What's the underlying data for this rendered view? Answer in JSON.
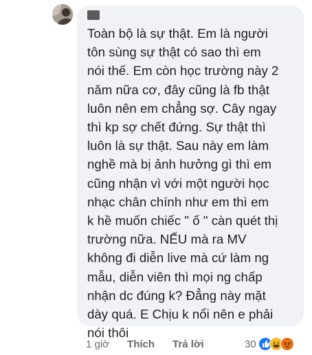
{
  "comment": {
    "author": "",
    "text": "Toàn bộ là sự thật. Em là người\ntôn sùng sự thật có sao thì em\nnói thế. Em còn học trường này 2\nnăm nữa cơ, đây cũng là fb thật\nluôn nên em chẳng sợ. Cây ngay\nthì kp sợ chết đứng. Sự thật thì\nluôn là sự thật. Sau này em làm\nnghề mà bị ảnh hưởng gì thì em\ncũng nhận vì với một người học\nnhạc chân chính như em thì em\nk hề muốn chiếc \" ố \" càn quét thị\ntrường nữa. NẾU mà ra MV\nkhông đi diễn live mà cứ làm ng\nmẫu, diễn viên thì mọi ng chấp\nnhận dc đúng k? Đẳng này mặt\ndày quá. E Chịu k nổi nên e phải\nnói thôi"
  },
  "actions": {
    "timestamp": "1 giờ",
    "like_label": "Thích",
    "reply_label": "Trả lời"
  },
  "reactions": {
    "count": "30",
    "icons": [
      "like-icon",
      "haha-icon",
      "angry-icon"
    ],
    "colors": {
      "like": "#1877f2",
      "haha": "#f7b928",
      "angry": "#e9710f"
    }
  },
  "colors": {
    "bubble": "#f0f2f5",
    "text": "#1c1e21",
    "meta": "#65676b"
  }
}
